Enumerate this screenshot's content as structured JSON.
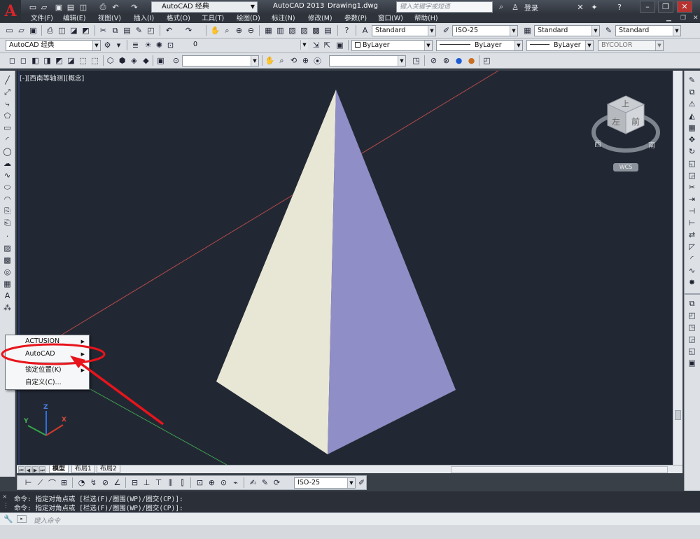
{
  "app": {
    "title": "AutoCAD 2013",
    "document": "Drawing1.dwg",
    "workspace": "AutoCAD 经典",
    "search_placeholder": "键入关键字或短语",
    "login_label": "登录"
  },
  "menu": [
    "文件(F)",
    "编辑(E)",
    "视图(V)",
    "插入(I)",
    "格式(O)",
    "工具(T)",
    "绘图(D)",
    "标注(N)",
    "修改(M)",
    "参数(P)",
    "窗口(W)",
    "帮助(H)"
  ],
  "styles_toolbar": {
    "text_style": "Standard",
    "dim_style": "ISO-25",
    "table_style": "Standard",
    "multileader_style": "Standard"
  },
  "layers_toolbar": {
    "workspace": "AutoCAD 经典",
    "layer": "0",
    "color": "ByLayer",
    "linetype": "ByLayer",
    "lineweight": "ByLayer",
    "plotstyle": "BYCOLOR"
  },
  "viewport": {
    "label": "[-][西南等轴测][概念]",
    "cube_top": "上",
    "cube_left": "左",
    "cube_front": "前",
    "compass_w": "西",
    "compass_s": "南",
    "wcs": "WCS",
    "ucs_x": "X",
    "ucs_y": "Y",
    "ucs_z": "Z"
  },
  "context_menu": {
    "items": [
      "ACTUSION",
      "AutoCAD",
      "锁定位置(K)",
      "自定义(C)..."
    ]
  },
  "layout_tabs": [
    "模型",
    "布局1",
    "布局2"
  ],
  "dim_toolbar": {
    "dim_style": "ISO-25"
  },
  "command": {
    "history": [
      "命令: 指定对角点或 [栏选(F)/圈围(WP)/圈交(CP)]:",
      "命令: 指定对角点或 [栏选(F)/圈围(WP)/圈交(CP)]:"
    ],
    "placeholder": "键入命令"
  },
  "colors": {
    "canvas_bg": "#222833",
    "pyramid_left": "#e8e7d6",
    "pyramid_right": "#8f8ec7",
    "highlight": "#e8141c"
  }
}
